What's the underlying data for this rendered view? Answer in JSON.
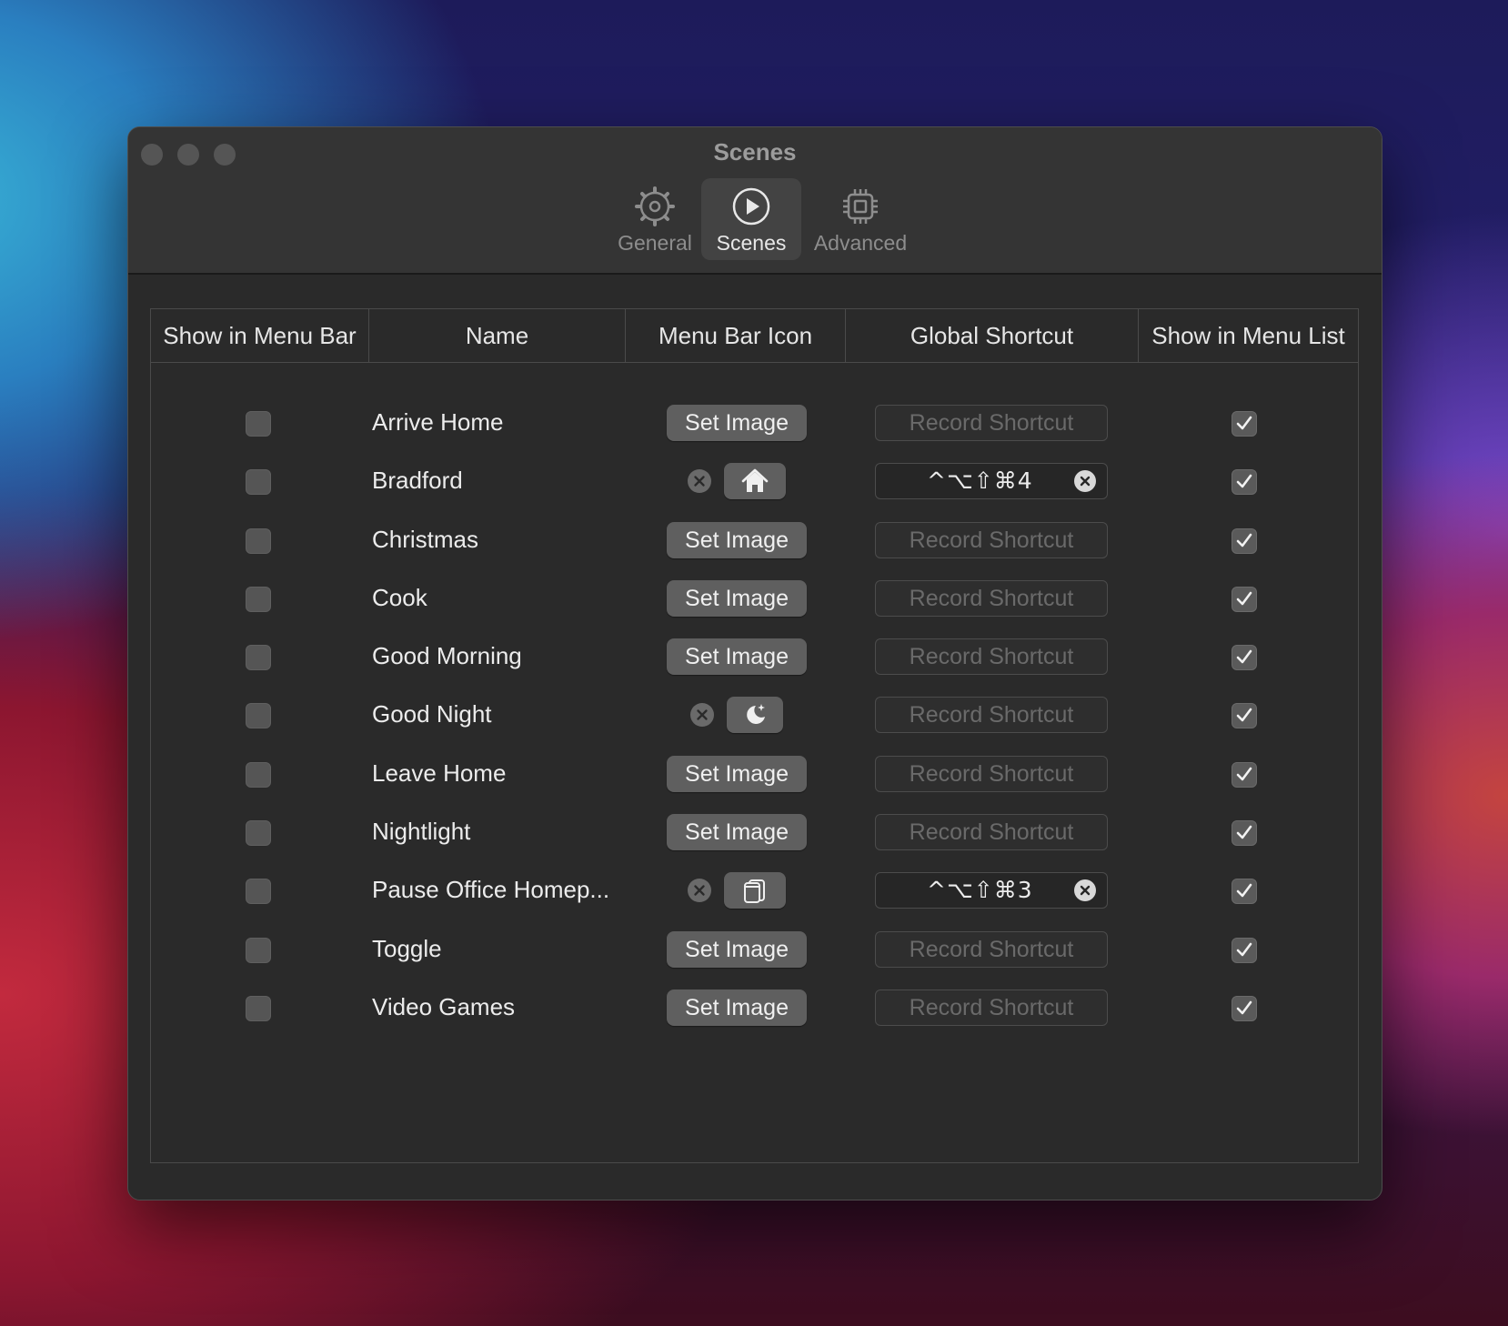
{
  "window": {
    "title": "Scenes",
    "tabs": [
      {
        "label": "General",
        "icon": "gear-icon"
      },
      {
        "label": "Scenes",
        "icon": "play-icon",
        "active": true
      },
      {
        "label": "Advanced",
        "icon": "chip-icon"
      }
    ]
  },
  "table": {
    "headers": [
      "Show in Menu Bar",
      "Name",
      "Menu Bar Icon",
      "Global Shortcut",
      "Show in Menu List"
    ],
    "set_image_label": "Set Image",
    "record_shortcut_label": "Record Shortcut",
    "rows": [
      {
        "name": "Arrive Home",
        "show_in_menu_bar": false,
        "icon": null,
        "shortcut": null,
        "show_in_menu_list": true
      },
      {
        "name": "Bradford",
        "show_in_menu_bar": false,
        "icon": "house-icon",
        "shortcut": "^⌥⇧⌘4",
        "show_in_menu_list": true
      },
      {
        "name": "Christmas",
        "show_in_menu_bar": false,
        "icon": null,
        "shortcut": null,
        "show_in_menu_list": true
      },
      {
        "name": "Cook",
        "show_in_menu_bar": false,
        "icon": null,
        "shortcut": null,
        "show_in_menu_list": true
      },
      {
        "name": "Good Morning",
        "show_in_menu_bar": false,
        "icon": null,
        "shortcut": null,
        "show_in_menu_list": true
      },
      {
        "name": "Good Night",
        "show_in_menu_bar": false,
        "icon": "moon-stars-icon",
        "shortcut": null,
        "show_in_menu_list": true
      },
      {
        "name": "Leave Home",
        "show_in_menu_bar": false,
        "icon": null,
        "shortcut": null,
        "show_in_menu_list": true
      },
      {
        "name": "Nightlight",
        "show_in_menu_bar": false,
        "icon": null,
        "shortcut": null,
        "show_in_menu_list": true
      },
      {
        "name": "Pause Office Homep...",
        "show_in_menu_bar": false,
        "icon": "copy-cylinder-icon",
        "shortcut": "^⌥⇧⌘3",
        "show_in_menu_list": true
      },
      {
        "name": "Toggle",
        "show_in_menu_bar": false,
        "icon": null,
        "shortcut": null,
        "show_in_menu_list": true
      },
      {
        "name": "Video Games",
        "show_in_menu_bar": false,
        "icon": null,
        "shortcut": null,
        "show_in_menu_list": true
      }
    ]
  },
  "colors": {
    "window_bg": "#2a2a2a",
    "titlebar_bg": "#343434",
    "active_tab_bg": "#434343"
  }
}
